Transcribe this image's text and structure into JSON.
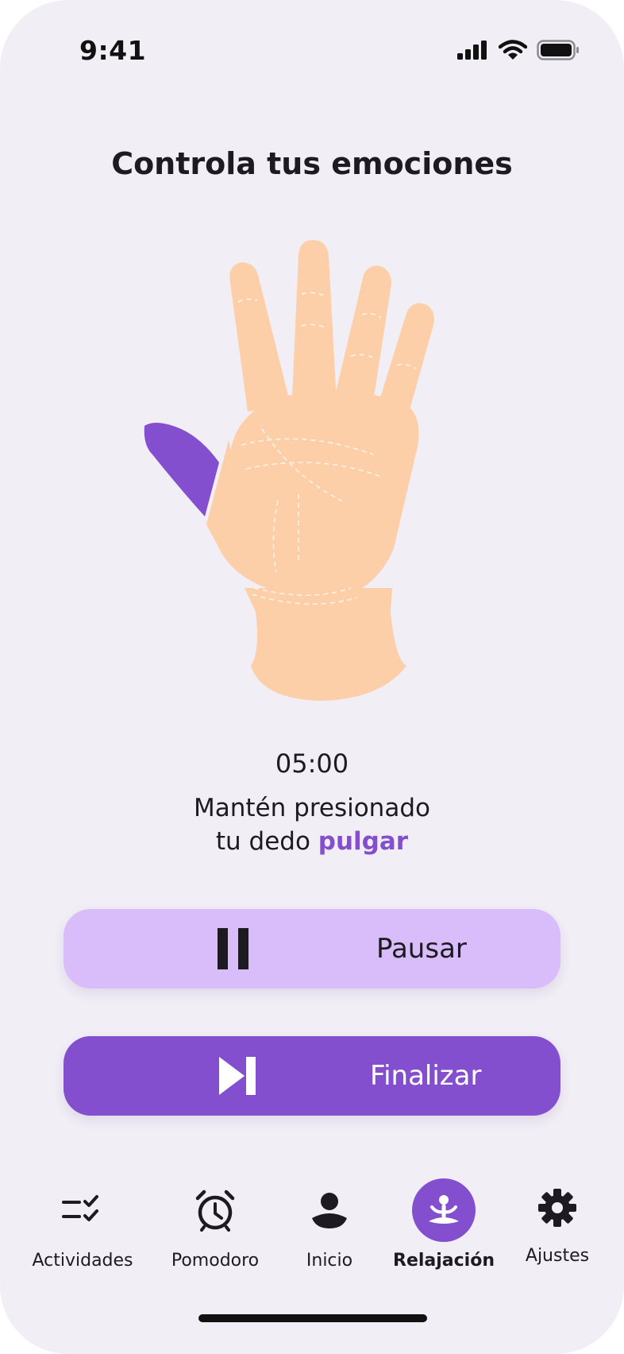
{
  "status_bar": {
    "time": "9:41"
  },
  "header": {
    "title": "Controla tus emociones"
  },
  "exercise": {
    "timer": "05:00",
    "instruction_line1": "Mantén presionado",
    "instruction_line2_prefix": "tu dedo ",
    "instruction_highlight": "pulgar",
    "highlighted_finger": "thumb"
  },
  "buttons": {
    "pause_label": "Pausar",
    "finish_label": "Finalizar"
  },
  "tabbar": {
    "active": "Relajación",
    "tabs": [
      {
        "label": "Actividades",
        "icon": "checklist-icon"
      },
      {
        "label": "Pomodoro",
        "icon": "alarm-clock-icon"
      },
      {
        "label": "Inicio",
        "icon": "user-icon"
      },
      {
        "label": "Relajación",
        "icon": "meditation-icon"
      },
      {
        "label": "Ajustes",
        "icon": "gear-icon"
      }
    ]
  },
  "colors": {
    "background": "#f1eef6",
    "accent": "#844fcf",
    "accent_light": "#d8bdfa",
    "skin": "#fdcfa9"
  }
}
